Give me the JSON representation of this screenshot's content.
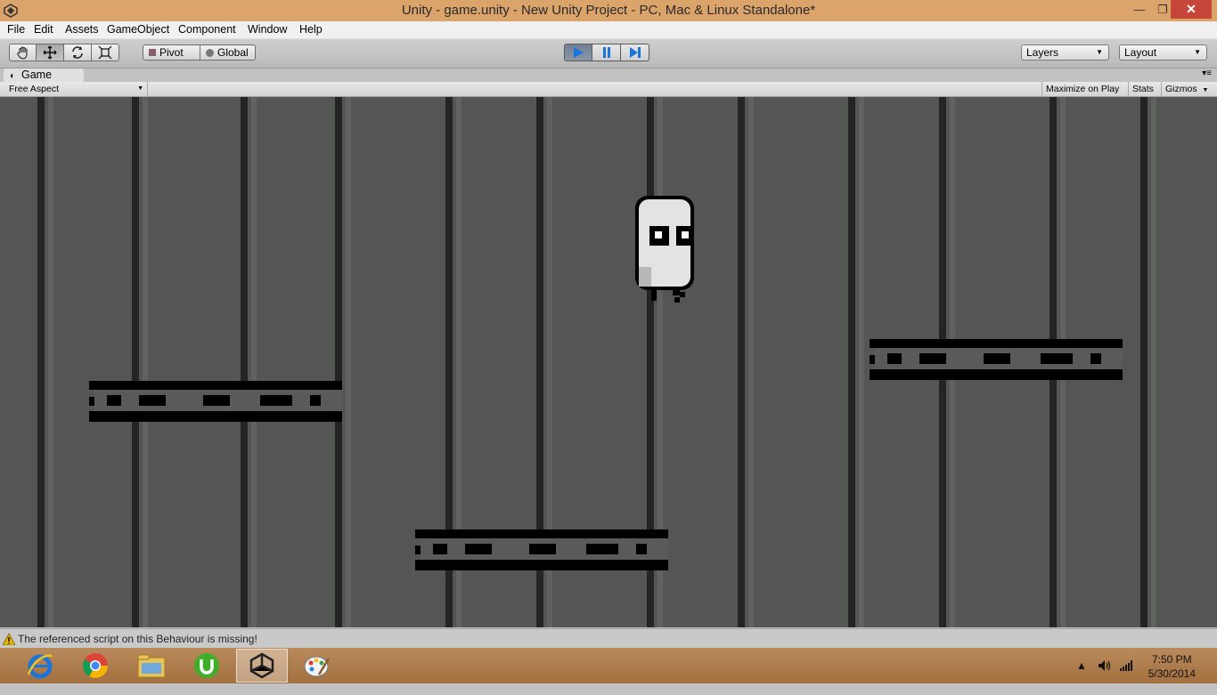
{
  "window": {
    "title": "Unity - game.unity - New Unity Project - PC, Mac & Linux Standalone*",
    "minimize_glyph": "—",
    "maximize_glyph": "❐",
    "close_glyph": "✕"
  },
  "menu": {
    "items": [
      "File",
      "Edit",
      "Assets",
      "GameObject",
      "Component",
      "Window",
      "Help"
    ]
  },
  "toolbar": {
    "pivot_label": "Pivot",
    "global_label": "Global",
    "layers_label": "Layers",
    "layout_label": "Layout",
    "play_state": "playing",
    "accent_color": "#1a73d8"
  },
  "game_tab": {
    "label": "Game",
    "aspect_label": "Free Aspect",
    "maximize_label": "Maximize on Play",
    "stats_label": "Stats",
    "gizmos_label": "Gizmos"
  },
  "status": {
    "message": "The referenced script on this Behaviour is missing!"
  },
  "taskbar": {
    "apps": [
      "internet-explorer-icon",
      "chrome-icon",
      "file-explorer-icon",
      "utorrent-icon",
      "unity-icon",
      "paint-icon"
    ],
    "active_app": "unity-icon",
    "time": "7:50 PM",
    "date": "5/30/2014"
  }
}
